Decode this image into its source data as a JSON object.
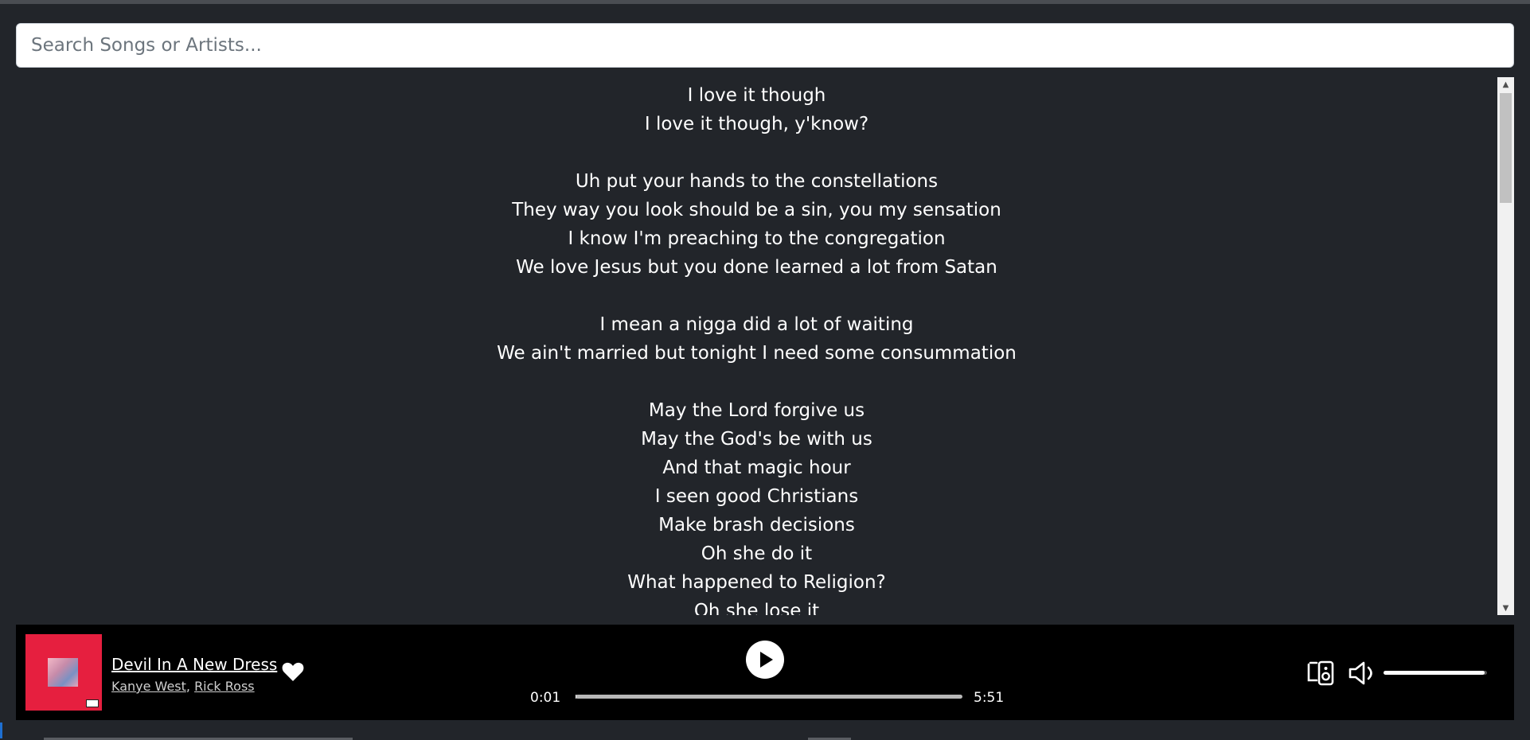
{
  "search": {
    "placeholder": "Search Songs or Artists..."
  },
  "lyrics": [
    "I love it though",
    "I love it though, y'know?",
    "",
    "Uh put your hands to the constellations",
    "They way you look should be a sin, you my sensation",
    "I know I'm preaching to the congregation",
    "We love Jesus but you done learned a lot from Satan",
    "",
    "I mean a nigga did a lot of waiting",
    "We ain't married but tonight I need some consummation",
    "",
    "May the Lord forgive us",
    "May the God's be with us",
    "And that magic hour",
    "I seen good Christians",
    "Make brash decisions",
    "Oh she do it",
    "What happened to Religion?",
    "Oh she lose it"
  ],
  "player": {
    "track_title": "Devil In A New Dress",
    "artists": [
      "Kanye West",
      "Rick Ross"
    ],
    "artist_separator": ", ",
    "time_elapsed": "0:01",
    "time_total": "5:51",
    "progress_fraction": 0.003,
    "volume_fraction": 0.98,
    "album_art_color": "#e61f3f"
  },
  "icons": {
    "like": "heart-icon",
    "play": "play-icon",
    "devices": "connect-device-icon",
    "volume": "volume-icon"
  }
}
